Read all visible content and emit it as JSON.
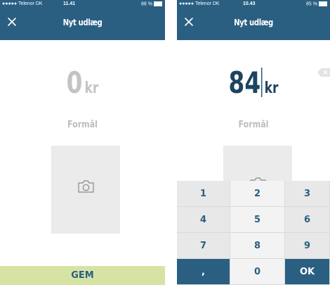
{
  "left_screen": {
    "status": {
      "carrier": "●●●●● Telenor DK",
      "time": "11.41",
      "battery": "88 %"
    },
    "title": "Nyt udlæg",
    "amount": "0",
    "currency": "kr",
    "purpose_placeholder": "Formål",
    "save_label": "GEM"
  },
  "right_screen": {
    "status": {
      "carrier": "●●●●● Telenor DK",
      "time": "10.43",
      "battery": "85 %"
    },
    "title": "Nyt udlæg",
    "amount": "84",
    "currency": "kr",
    "purpose_placeholder": "Formål",
    "keypad": {
      "keys": [
        "1",
        "2",
        "3",
        "4",
        "5",
        "6",
        "7",
        "8",
        "9",
        ",",
        "0",
        "OK"
      ]
    }
  },
  "colors": {
    "header": "#2a5f82",
    "save_button": "#d7e3a5",
    "amount_active": "#1d4460",
    "amount_empty": "#c3c3c3"
  }
}
